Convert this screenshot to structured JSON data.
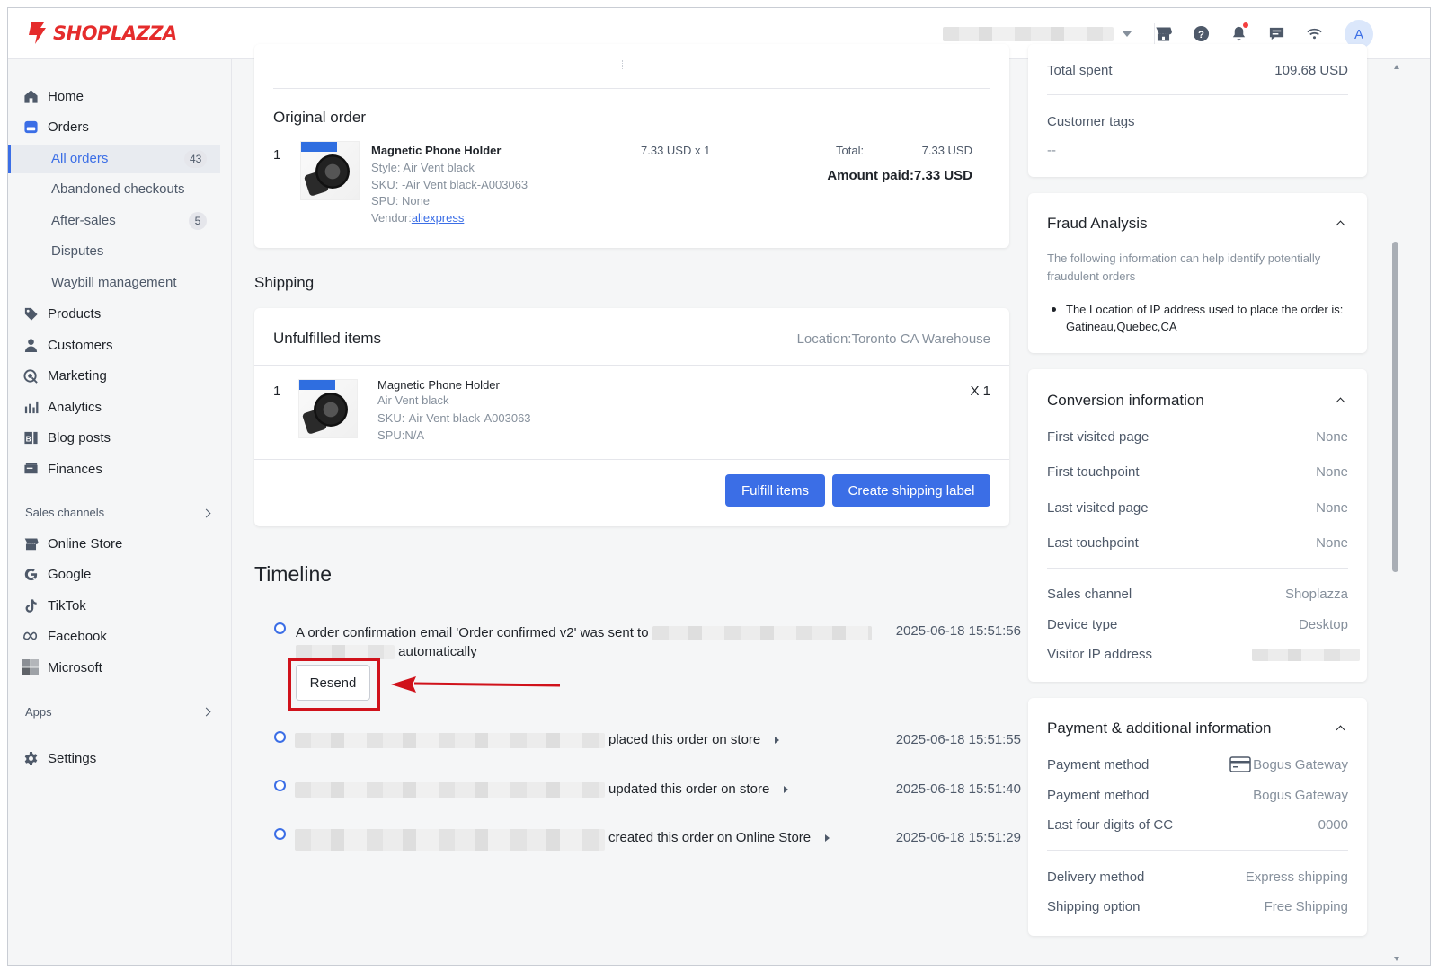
{
  "brand": {
    "name": "SHOPLAZZA",
    "color": "#e52c2c"
  },
  "accent": "#3b6ee6",
  "header": {
    "avatar_letter": "A",
    "icons": [
      "store-icon",
      "help-icon",
      "bell-icon",
      "chat-icon",
      "wifi-icon"
    ]
  },
  "sidebar": {
    "items": [
      {
        "label": "Home",
        "icon": "home-icon"
      },
      {
        "label": "Orders",
        "icon": "orders-icon"
      },
      {
        "label": "Products",
        "icon": "tag-icon"
      },
      {
        "label": "Customers",
        "icon": "person-icon"
      },
      {
        "label": "Marketing",
        "icon": "marketing-icon"
      },
      {
        "label": "Analytics",
        "icon": "bar-chart-icon"
      },
      {
        "label": "Blog posts",
        "icon": "blog-icon"
      },
      {
        "label": "Finances",
        "icon": "finance-icon"
      }
    ],
    "orders_sub": [
      {
        "label": "All orders",
        "count": "43"
      },
      {
        "label": "Abandoned checkouts"
      },
      {
        "label": "After-sales",
        "count": "5"
      },
      {
        "label": "Disputes"
      },
      {
        "label": "Waybill management"
      }
    ],
    "sales_channels_label": "Sales channels",
    "channels": [
      {
        "label": "Online Store",
        "icon": "store-icon"
      },
      {
        "label": "Google",
        "icon": "google-icon"
      },
      {
        "label": "TikTok",
        "icon": "tiktok-icon"
      },
      {
        "label": "Facebook",
        "icon": "meta-icon"
      },
      {
        "label": "Microsoft",
        "icon": "microsoft-icon"
      }
    ],
    "apps_label": "Apps",
    "settings_label": "Settings"
  },
  "original_order": {
    "title": "Original order",
    "qty": "1",
    "product_name": "Magnetic Phone Holder",
    "style": "Style: Air Vent black",
    "sku": "SKU: -Air Vent black-A003063",
    "spu": "SPU: None",
    "vendor_label": "Vendor:",
    "vendor_link": "aliexpress",
    "unit_price": "7.33 USD x 1",
    "total_label": "Total:",
    "total_value": "7.33 USD",
    "amount_paid": "Amount paid:7.33 USD"
  },
  "shipping": {
    "title": "Shipping",
    "unfulfilled_title": "Unfulfilled items",
    "location": "Location:Toronto CA Warehouse",
    "qty": "1",
    "product_name": "Magnetic Phone Holder",
    "variant": "Air Vent black",
    "sku": "SKU:-Air Vent black-A003063",
    "spu": "SPU:N/A",
    "quantity_label": "X 1",
    "fulfill_button": "Fulfill items",
    "label_button": "Create shipping label"
  },
  "timeline": {
    "title": "Timeline",
    "events": [
      {
        "text": "A order confirmation email 'Order confirmed v2' was sent to",
        "suffix": "automatically",
        "time": "2025-06-18 15:51:56"
      },
      {
        "text": "placed this order on store",
        "time": "2025-06-18 15:51:55"
      },
      {
        "text": "updated this order on store",
        "time": "2025-06-18 15:51:40"
      },
      {
        "text": "created this order on Online Store",
        "time": "2025-06-18 15:51:29"
      }
    ],
    "resend_button": "Resend"
  },
  "customer": {
    "total_spent_label": "Total spent",
    "total_spent_value": "109.68 USD",
    "tags_label": "Customer tags",
    "tags_value": "--"
  },
  "fraud": {
    "title": "Fraud Analysis",
    "description": "The following information can help identify potentially fraudulent orders",
    "bullet": "The Location of IP address used to place the order is: Gatineau,Quebec,CA"
  },
  "conversion": {
    "title": "Conversion information",
    "rows": [
      {
        "label": "First visited page",
        "value": "None"
      },
      {
        "label": "First touchpoint",
        "value": "None"
      },
      {
        "label": "Last visited page",
        "value": "None"
      },
      {
        "label": "Last touchpoint",
        "value": "None"
      }
    ],
    "rows2": [
      {
        "label": "Sales channel",
        "value": "Shoplazza"
      },
      {
        "label": "Device type",
        "value": "Desktop"
      },
      {
        "label": "Visitor IP address",
        "value": ""
      }
    ]
  },
  "payment": {
    "title": "Payment & additional information",
    "rows": [
      {
        "label": "Payment method",
        "value": "Bogus Gateway"
      },
      {
        "label": "Payment method",
        "value": "Bogus Gateway"
      },
      {
        "label": "Last four digits of CC",
        "value": "0000"
      }
    ],
    "rows2": [
      {
        "label": "Delivery method",
        "value": "Express shipping"
      },
      {
        "label": "Shipping option",
        "value": "Free Shipping"
      }
    ]
  },
  "annotation_color": "#d0121b"
}
